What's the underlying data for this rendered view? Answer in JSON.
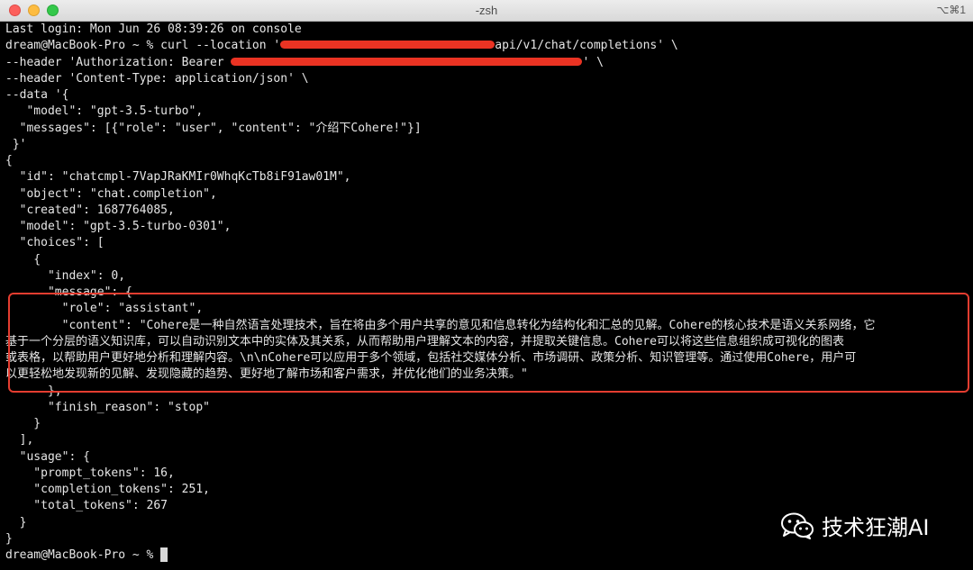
{
  "window": {
    "title": "-zsh",
    "shortcut": "⌥⌘1",
    "colors": {
      "background": "#000000",
      "text": "#e6e6e6",
      "redaction": "#ea3323",
      "highlight_box": "#e43d30"
    }
  },
  "terminal": {
    "lines": [
      "Last login: Mon Jun 26 08:39:26 on console",
      "dream@MacBook-Pro ~ % curl --location '",
      "api/v1/chat/completions' \\",
      "--header 'Authorization: Bearer ",
      "' \\",
      "--header 'Content-Type: application/json' \\",
      "--data '{",
      "   \"model\": \"gpt-3.5-turbo\",",
      "  \"messages\": [{\"role\": \"user\", \"content\": \"介绍下Cohere!\"}]",
      " }'",
      "{",
      "  \"id\": \"chatcmpl-7VapJRaKMIr0WhqKcTb8iF91aw01M\",",
      "  \"object\": \"chat.completion\",",
      "  \"created\": 1687764085,",
      "  \"model\": \"gpt-3.5-turbo-0301\",",
      "  \"choices\": [",
      "    {",
      "      \"index\": 0,",
      "      \"message\": {",
      "        \"role\": \"assistant\",",
      "        \"content\": \"Cohere是一种自然语言处理技术，旨在将由多个用户共享的意见和信息转化为结构化和汇总的见解。Cohere的核心技术是语义关系网络，它",
      "基于一个分层的语义知识库，可以自动识别文本中的实体及其关系，从而帮助用户理解文本的内容，并提取关键信息。Cohere可以将这些信息组织成可视化的图表",
      "或表格，以帮助用户更好地分析和理解内容。\\n\\nCohere可以应用于多个领域，包括社交媒体分析、市场调研、政策分析、知识管理等。通过使用Cohere，用户可",
      "以更轻松地发现新的见解、发现隐藏的趋势、更好地了解市场和客户需求，并优化他们的业务决策。\"",
      "      },",
      "      \"finish_reason\": \"stop\"",
      "    }",
      "  ],",
      "  \"usage\": {",
      "    \"prompt_tokens\": 16,",
      "    \"completion_tokens\": 251,",
      "    \"total_tokens\": 267",
      "  }",
      "}",
      "dream@MacBook-Pro ~ % "
    ]
  },
  "watermark": {
    "icon": "wechat-icon",
    "text": "技术狂潮AI"
  }
}
